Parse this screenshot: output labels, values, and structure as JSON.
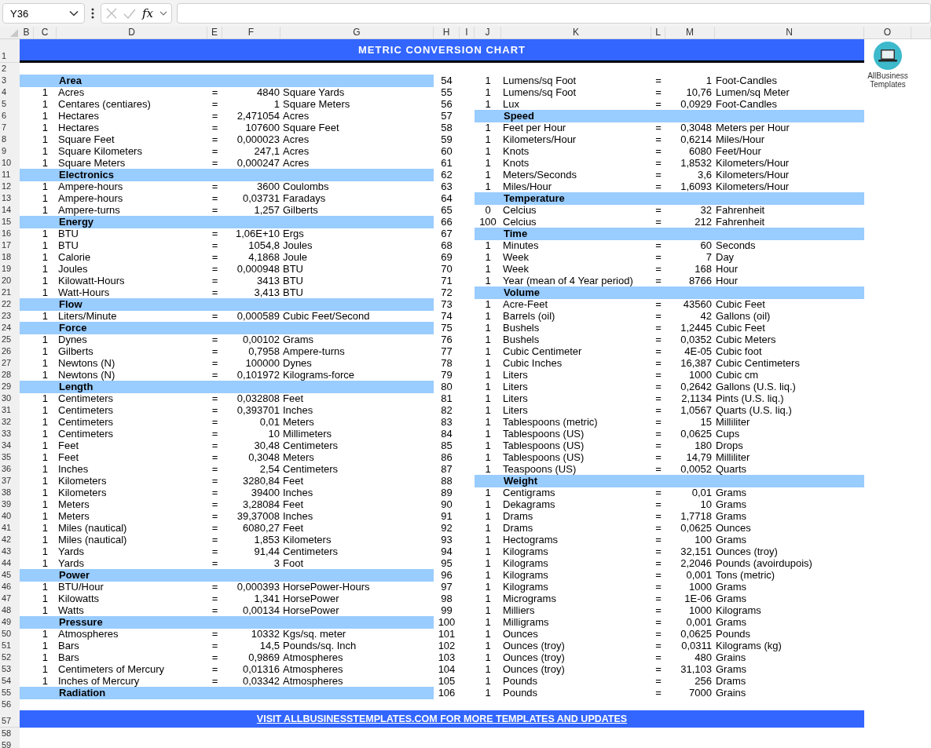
{
  "formula_bar": {
    "name_box": "Y36",
    "fx": "fx"
  },
  "columns": [
    "B",
    "C",
    "D",
    "E",
    "F",
    "G",
    "H",
    "I",
    "J",
    "K",
    "L",
    "M",
    "N",
    "O"
  ],
  "logo": {
    "text": "AllBusiness Templates"
  },
  "rows": [
    {
      "header": "1",
      "kind": "title",
      "text": "METRIC CONVERSION CHART"
    },
    {
      "header": "2",
      "kind": "blank"
    },
    {
      "header": "3",
      "kind": "data",
      "left": {
        "kind": "category",
        "label": "Area"
      },
      "right": {
        "number": "54",
        "kind": "conversion",
        "qty": "1",
        "from": "Lumens/sq Foot",
        "eq": "=",
        "value": "1",
        "unit": "Foot-Candles"
      }
    },
    {
      "header": "4",
      "kind": "data",
      "left": {
        "kind": "conversion",
        "qty": "1",
        "from": "Acres",
        "eq": "=",
        "value": "4840",
        "unit": "Square Yards"
      },
      "right": {
        "number": "55",
        "kind": "conversion",
        "qty": "1",
        "from": "Lumens/sq Foot",
        "eq": "=",
        "value": "10,76",
        "unit": "Lumen/sq Meter"
      }
    },
    {
      "header": "5",
      "kind": "data",
      "left": {
        "kind": "conversion",
        "qty": "1",
        "from": "Centares (centiares)",
        "eq": "=",
        "value": "1",
        "unit": "Square Meters"
      },
      "right": {
        "number": "56",
        "kind": "conversion",
        "qty": "1",
        "from": "Lux",
        "eq": "=",
        "value": "0,0929",
        "unit": "Foot-Candles"
      }
    },
    {
      "header": "6",
      "kind": "data",
      "left": {
        "kind": "conversion",
        "qty": "1",
        "from": "Hectares",
        "eq": "=",
        "value": "2,471054",
        "unit": "Acres"
      },
      "right": {
        "number": "57",
        "kind": "category",
        "label": "Speed"
      }
    },
    {
      "header": "7",
      "kind": "data",
      "left": {
        "kind": "conversion",
        "qty": "1",
        "from": "Hectares",
        "eq": "=",
        "value": "107600",
        "unit": "Square Feet"
      },
      "right": {
        "number": "58",
        "kind": "conversion",
        "qty": "1",
        "from": "Feet per Hour",
        "eq": "=",
        "value": "0,3048",
        "unit": "Meters per Hour"
      }
    },
    {
      "header": "8",
      "kind": "data",
      "left": {
        "kind": "conversion",
        "qty": "1",
        "from": "Square Feet",
        "eq": "=",
        "value": "0,000023",
        "unit": "Acres"
      },
      "right": {
        "number": "59",
        "kind": "conversion",
        "qty": "1",
        "from": "Kilometers/Hour",
        "eq": "=",
        "value": "0,6214",
        "unit": "Miles/Hour"
      }
    },
    {
      "header": "9",
      "kind": "data",
      "left": {
        "kind": "conversion",
        "qty": "1",
        "from": "Square Kilometers",
        "eq": "=",
        "value": "247,1",
        "unit": "Acres"
      },
      "right": {
        "number": "60",
        "kind": "conversion",
        "qty": "1",
        "from": "Knots",
        "eq": "=",
        "value": "6080",
        "unit": "Feet/Hour"
      }
    },
    {
      "header": "10",
      "kind": "data",
      "left": {
        "kind": "conversion",
        "qty": "1",
        "from": "Square Meters",
        "eq": "=",
        "value": "0,000247",
        "unit": "Acres"
      },
      "right": {
        "number": "61",
        "kind": "conversion",
        "qty": "1",
        "from": "Knots",
        "eq": "=",
        "value": "1,8532",
        "unit": "Kilometers/Hour"
      }
    },
    {
      "header": "11",
      "kind": "data",
      "left": {
        "kind": "category",
        "label": "Electronics"
      },
      "right": {
        "number": "62",
        "kind": "conversion",
        "qty": "1",
        "from": "Meters/Seconds",
        "eq": "=",
        "value": "3,6",
        "unit": "Kilometers/Hour"
      }
    },
    {
      "header": "12",
      "kind": "data",
      "left": {
        "kind": "conversion",
        "qty": "1",
        "from": "Ampere-hours",
        "eq": "=",
        "value": "3600",
        "unit": "Coulombs"
      },
      "right": {
        "number": "63",
        "kind": "conversion",
        "qty": "1",
        "from": "Miles/Hour",
        "eq": "=",
        "value": "1,6093",
        "unit": "Kilometers/Hour"
      }
    },
    {
      "header": "13",
      "kind": "data",
      "left": {
        "kind": "conversion",
        "qty": "1",
        "from": "Ampere-hours",
        "eq": "=",
        "value": "0,03731",
        "unit": "Faradays"
      },
      "right": {
        "number": "64",
        "kind": "category",
        "label": "Temperature"
      }
    },
    {
      "header": "14",
      "kind": "data",
      "left": {
        "kind": "conversion",
        "qty": "1",
        "from": "Ampere-turns",
        "eq": "=",
        "value": "1,257",
        "unit": "Gilberts"
      },
      "right": {
        "number": "65",
        "kind": "conversion",
        "qty": "0",
        "from": "Celcius",
        "eq": "=",
        "value": "32",
        "unit": "Fahrenheit"
      }
    },
    {
      "header": "15",
      "kind": "data",
      "left": {
        "kind": "category",
        "label": "Energy"
      },
      "right": {
        "number": "66",
        "kind": "conversion",
        "qty": "100",
        "from": "Celcius",
        "eq": "=",
        "value": "212",
        "unit": "Fahrenheit"
      }
    },
    {
      "header": "16",
      "kind": "data",
      "left": {
        "kind": "conversion",
        "qty": "1",
        "from": "BTU",
        "eq": "=",
        "value": "1,06E+10",
        "unit": "Ergs"
      },
      "right": {
        "number": "67",
        "kind": "category",
        "label": "Time"
      }
    },
    {
      "header": "17",
      "kind": "data",
      "left": {
        "kind": "conversion",
        "qty": "1",
        "from": "BTU",
        "eq": "=",
        "value": "1054,8",
        "unit": "Joules"
      },
      "right": {
        "number": "68",
        "kind": "conversion",
        "qty": "1",
        "from": "Minutes",
        "eq": "=",
        "value": "60",
        "unit": "Seconds"
      }
    },
    {
      "header": "18",
      "kind": "data",
      "left": {
        "kind": "conversion",
        "qty": "1",
        "from": "Calorie",
        "eq": "=",
        "value": "4,1868",
        "unit": "Joule"
      },
      "right": {
        "number": "69",
        "kind": "conversion",
        "qty": "1",
        "from": "Week",
        "eq": "=",
        "value": "7",
        "unit": "Day"
      }
    },
    {
      "header": "19",
      "kind": "data",
      "left": {
        "kind": "conversion",
        "qty": "1",
        "from": "Joules",
        "eq": "=",
        "value": "0,000948",
        "unit": "BTU"
      },
      "right": {
        "number": "70",
        "kind": "conversion",
        "qty": "1",
        "from": "Week",
        "eq": "=",
        "value": "168",
        "unit": "Hour"
      }
    },
    {
      "header": "20",
      "kind": "data",
      "left": {
        "kind": "conversion",
        "qty": "1",
        "from": "Kilowatt-Hours",
        "eq": "=",
        "value": "3413",
        "unit": "BTU"
      },
      "right": {
        "number": "71",
        "kind": "conversion",
        "qty": "1",
        "from": "Year (mean of 4 Year period)",
        "eq": "=",
        "value": "8766",
        "unit": "Hour"
      }
    },
    {
      "header": "21",
      "kind": "data",
      "left": {
        "kind": "conversion",
        "qty": "1",
        "from": "Watt-Hours",
        "eq": "=",
        "value": "3,413",
        "unit": "BTU"
      },
      "right": {
        "number": "72",
        "kind": "category",
        "label": "Volume"
      }
    },
    {
      "header": "22",
      "kind": "data",
      "left": {
        "kind": "category",
        "label": "Flow"
      },
      "right": {
        "number": "73",
        "kind": "conversion",
        "qty": "1",
        "from": "Acre-Feet",
        "eq": "=",
        "value": "43560",
        "unit": "Cubic Feet"
      }
    },
    {
      "header": "23",
      "kind": "data",
      "left": {
        "kind": "conversion",
        "qty": "1",
        "from": "Liters/Minute",
        "eq": "=",
        "value": "0,000589",
        "unit": "Cubic Feet/Second"
      },
      "right": {
        "number": "74",
        "kind": "conversion",
        "qty": "1",
        "from": "Barrels (oil)",
        "eq": "=",
        "value": "42",
        "unit": "Gallons (oil)"
      }
    },
    {
      "header": "24",
      "kind": "data",
      "left": {
        "kind": "category",
        "label": "Force"
      },
      "right": {
        "number": "75",
        "kind": "conversion",
        "qty": "1",
        "from": "Bushels",
        "eq": "=",
        "value": "1,2445",
        "unit": "Cubic Feet"
      }
    },
    {
      "header": "25",
      "kind": "data",
      "left": {
        "kind": "conversion",
        "qty": "1",
        "from": "Dynes",
        "eq": "=",
        "value": "0,00102",
        "unit": "Grams"
      },
      "right": {
        "number": "76",
        "kind": "conversion",
        "qty": "1",
        "from": "Bushels",
        "eq": "=",
        "value": "0,0352",
        "unit": "Cubic Meters"
      }
    },
    {
      "header": "26",
      "kind": "data",
      "left": {
        "kind": "conversion",
        "qty": "1",
        "from": "Gilberts",
        "eq": "=",
        "value": "0,7958",
        "unit": "Ampere-turns"
      },
      "right": {
        "number": "77",
        "kind": "conversion",
        "qty": "1",
        "from": "Cubic Centimeter",
        "eq": "=",
        "value": "4E-05",
        "unit": "Cubic foot"
      }
    },
    {
      "header": "27",
      "kind": "data",
      "left": {
        "kind": "conversion",
        "qty": "1",
        "from": "Newtons (N)",
        "eq": "=",
        "value": "100000",
        "unit": "Dynes"
      },
      "right": {
        "number": "78",
        "kind": "conversion",
        "qty": "1",
        "from": "Cubic Inches",
        "eq": "=",
        "value": "16,387",
        "unit": "Cubic Centimeters"
      }
    },
    {
      "header": "28",
      "kind": "data",
      "left": {
        "kind": "conversion",
        "qty": "1",
        "from": "Newtons (N)",
        "eq": "=",
        "value": "0,101972",
        "unit": "Kilograms-force"
      },
      "right": {
        "number": "79",
        "kind": "conversion",
        "qty": "1",
        "from": "Liters",
        "eq": "=",
        "value": "1000",
        "unit": "Cubic cm"
      }
    },
    {
      "header": "29",
      "kind": "data",
      "left": {
        "kind": "category",
        "label": "Length"
      },
      "right": {
        "number": "80",
        "kind": "conversion",
        "qty": "1",
        "from": "Liters",
        "eq": "=",
        "value": "0,2642",
        "unit": "Gallons (U.S. liq.)"
      }
    },
    {
      "header": "30",
      "kind": "data",
      "left": {
        "kind": "conversion",
        "qty": "1",
        "from": "Centimeters",
        "eq": "=",
        "value": "0,032808",
        "unit": "Feet"
      },
      "right": {
        "number": "81",
        "kind": "conversion",
        "qty": "1",
        "from": "Liters",
        "eq": "=",
        "value": "2,1134",
        "unit": "Pints (U.S. liq.)"
      }
    },
    {
      "header": "31",
      "kind": "data",
      "left": {
        "kind": "conversion",
        "qty": "1",
        "from": "Centimeters",
        "eq": "=",
        "value": "0,393701",
        "unit": "Inches"
      },
      "right": {
        "number": "82",
        "kind": "conversion",
        "qty": "1",
        "from": "Liters",
        "eq": "=",
        "value": "1,0567",
        "unit": "Quarts (U.S. liq.)"
      }
    },
    {
      "header": "32",
      "kind": "data",
      "left": {
        "kind": "conversion",
        "qty": "1",
        "from": "Centimeters",
        "eq": "=",
        "value": "0,01",
        "unit": "Meters"
      },
      "right": {
        "number": "83",
        "kind": "conversion",
        "qty": "1",
        "from": "Tablespoons (metric)",
        "eq": "=",
        "value": "15",
        "unit": "Milliliter"
      }
    },
    {
      "header": "33",
      "kind": "data",
      "left": {
        "kind": "conversion",
        "qty": "1",
        "from": "Centimeters",
        "eq": "=",
        "value": "10",
        "unit": "Millimeters"
      },
      "right": {
        "number": "84",
        "kind": "conversion",
        "qty": "1",
        "from": "Tablespoons (US)",
        "eq": "=",
        "value": "0,0625",
        "unit": "Cups"
      }
    },
    {
      "header": "34",
      "kind": "data",
      "left": {
        "kind": "conversion",
        "qty": "1",
        "from": "Feet",
        "eq": "=",
        "value": "30,48",
        "unit": "Centimeters"
      },
      "right": {
        "number": "85",
        "kind": "conversion",
        "qty": "1",
        "from": "Tablespoons (US)",
        "eq": "=",
        "value": "180",
        "unit": "Drops"
      }
    },
    {
      "header": "35",
      "kind": "data",
      "left": {
        "kind": "conversion",
        "qty": "1",
        "from": "Feet",
        "eq": "=",
        "value": "0,3048",
        "unit": "Meters"
      },
      "right": {
        "number": "86",
        "kind": "conversion",
        "qty": "1",
        "from": "Tablespoons (US)",
        "eq": "=",
        "value": "14,79",
        "unit": "Milliliter"
      }
    },
    {
      "header": "36",
      "kind": "data",
      "left": {
        "kind": "conversion",
        "qty": "1",
        "from": "Inches",
        "eq": "=",
        "value": "2,54",
        "unit": "Centimeters"
      },
      "right": {
        "number": "87",
        "kind": "conversion",
        "qty": "1",
        "from": "Teaspoons (US)",
        "eq": "=",
        "value": "0,0052",
        "unit": "Quarts"
      }
    },
    {
      "header": "37",
      "kind": "data",
      "left": {
        "kind": "conversion",
        "qty": "1",
        "from": "Kilometers",
        "eq": "=",
        "value": "3280,84",
        "unit": "Feet"
      },
      "right": {
        "number": "88",
        "kind": "category",
        "label": "Weight"
      }
    },
    {
      "header": "38",
      "kind": "data",
      "left": {
        "kind": "conversion",
        "qty": "1",
        "from": "Kilometers",
        "eq": "=",
        "value": "39400",
        "unit": "Inches"
      },
      "right": {
        "number": "89",
        "kind": "conversion",
        "qty": "1",
        "from": "Centigrams",
        "eq": "=",
        "value": "0,01",
        "unit": "Grams"
      }
    },
    {
      "header": "39",
      "kind": "data",
      "left": {
        "kind": "conversion",
        "qty": "1",
        "from": "Meters",
        "eq": "=",
        "value": "3,28084",
        "unit": "Feet"
      },
      "right": {
        "number": "90",
        "kind": "conversion",
        "qty": "1",
        "from": "Dekagrams",
        "eq": "=",
        "value": "10",
        "unit": "Grams"
      }
    },
    {
      "header": "40",
      "kind": "data",
      "left": {
        "kind": "conversion",
        "qty": "1",
        "from": "Meters",
        "eq": "=",
        "value": "39,37008",
        "unit": "Inches"
      },
      "right": {
        "number": "91",
        "kind": "conversion",
        "qty": "1",
        "from": "Drams",
        "eq": "=",
        "value": "1,7718",
        "unit": "Grams"
      }
    },
    {
      "header": "41",
      "kind": "data",
      "left": {
        "kind": "conversion",
        "qty": "1",
        "from": "Miles (nautical)",
        "eq": "=",
        "value": "6080,27",
        "unit": "Feet"
      },
      "right": {
        "number": "92",
        "kind": "conversion",
        "qty": "1",
        "from": "Drams",
        "eq": "=",
        "value": "0,0625",
        "unit": "Ounces"
      }
    },
    {
      "header": "42",
      "kind": "data",
      "left": {
        "kind": "conversion",
        "qty": "1",
        "from": "Miles (nautical)",
        "eq": "=",
        "value": "1,853",
        "unit": "Kilometers"
      },
      "right": {
        "number": "93",
        "kind": "conversion",
        "qty": "1",
        "from": "Hectograms",
        "eq": "=",
        "value": "100",
        "unit": "Grams"
      }
    },
    {
      "header": "43",
      "kind": "data",
      "left": {
        "kind": "conversion",
        "qty": "1",
        "from": "Yards",
        "eq": "=",
        "value": "91,44",
        "unit": "Centimeters"
      },
      "right": {
        "number": "94",
        "kind": "conversion",
        "qty": "1",
        "from": "Kilograms",
        "eq": "=",
        "value": "32,151",
        "unit": "Ounces (troy)"
      }
    },
    {
      "header": "44",
      "kind": "data",
      "left": {
        "kind": "conversion",
        "qty": "1",
        "from": "Yards",
        "eq": "=",
        "value": "3",
        "unit": "Foot"
      },
      "right": {
        "number": "95",
        "kind": "conversion",
        "qty": "1",
        "from": "Kilograms",
        "eq": "=",
        "value": "2,2046",
        "unit": "Pounds (avoirdupois)"
      }
    },
    {
      "header": "45",
      "kind": "data",
      "left": {
        "kind": "category",
        "label": "Power"
      },
      "right": {
        "number": "96",
        "kind": "conversion",
        "qty": "1",
        "from": "Kilograms",
        "eq": "=",
        "value": "0,001",
        "unit": "Tons (metric)"
      }
    },
    {
      "header": "46",
      "kind": "data",
      "left": {
        "kind": "conversion",
        "qty": "1",
        "from": "BTU/Hour",
        "eq": "=",
        "value": "0,000393",
        "unit": "HorsePower-Hours"
      },
      "right": {
        "number": "97",
        "kind": "conversion",
        "qty": "1",
        "from": "Kilograms",
        "eq": "=",
        "value": "1000",
        "unit": "Grams"
      }
    },
    {
      "header": "47",
      "kind": "data",
      "left": {
        "kind": "conversion",
        "qty": "1",
        "from": "Kilowatts",
        "eq": "=",
        "value": "1,341",
        "unit": "HorsePower"
      },
      "right": {
        "number": "98",
        "kind": "conversion",
        "qty": "1",
        "from": "Micrograms",
        "eq": "=",
        "value": "1E-06",
        "unit": "Grams"
      }
    },
    {
      "header": "48",
      "kind": "data",
      "left": {
        "kind": "conversion",
        "qty": "1",
        "from": "Watts",
        "eq": "=",
        "value": "0,00134",
        "unit": "HorsePower"
      },
      "right": {
        "number": "99",
        "kind": "conversion",
        "qty": "1",
        "from": "Milliers",
        "eq": "=",
        "value": "1000",
        "unit": "Kilograms"
      }
    },
    {
      "header": "49",
      "kind": "data",
      "left": {
        "kind": "category",
        "label": "Pressure"
      },
      "right": {
        "number": "100",
        "kind": "conversion",
        "qty": "1",
        "from": "Milligrams",
        "eq": "=",
        "value": "0,001",
        "unit": "Grams"
      }
    },
    {
      "header": "50",
      "kind": "data",
      "left": {
        "kind": "conversion",
        "qty": "1",
        "from": "Atmospheres",
        "eq": "=",
        "value": "10332",
        "unit": "Kgs/sq. meter"
      },
      "right": {
        "number": "101",
        "kind": "conversion",
        "qty": "1",
        "from": "Ounces",
        "eq": "=",
        "value": "0,0625",
        "unit": "Pounds"
      }
    },
    {
      "header": "51",
      "kind": "data",
      "left": {
        "kind": "conversion",
        "qty": "1",
        "from": "Bars",
        "eq": "=",
        "value": "14,5",
        "unit": "Pounds/sq. Inch"
      },
      "right": {
        "number": "102",
        "kind": "conversion",
        "qty": "1",
        "from": "Ounces (troy)",
        "eq": "=",
        "value": "0,0311",
        "unit": "Kilograms (kg)"
      }
    },
    {
      "header": "52",
      "kind": "data",
      "left": {
        "kind": "conversion",
        "qty": "1",
        "from": "Bars",
        "eq": "=",
        "value": "0,9869",
        "unit": "Atmospheres"
      },
      "right": {
        "number": "103",
        "kind": "conversion",
        "qty": "1",
        "from": "Ounces (troy)",
        "eq": "=",
        "value": "480",
        "unit": "Grains"
      }
    },
    {
      "header": "53",
      "kind": "data",
      "left": {
        "kind": "conversion",
        "qty": "1",
        "from": "Centimeters of Mercury",
        "eq": "=",
        "value": "0,01316",
        "unit": "Atmospheres"
      },
      "right": {
        "number": "104",
        "kind": "conversion",
        "qty": "1",
        "from": "Ounces (troy)",
        "eq": "=",
        "value": "31,103",
        "unit": "Grams"
      }
    },
    {
      "header": "54",
      "kind": "data",
      "left": {
        "kind": "conversion",
        "qty": "1",
        "from": "Inches of Mercury",
        "eq": "=",
        "value": "0,03342",
        "unit": "Atmospheres"
      },
      "right": {
        "number": "105",
        "kind": "conversion",
        "qty": "1",
        "from": "Pounds",
        "eq": "=",
        "value": "256",
        "unit": "Drams"
      }
    },
    {
      "header": "55",
      "kind": "data",
      "left": {
        "kind": "category",
        "label": "Radiation"
      },
      "right": {
        "number": "106",
        "kind": "conversion",
        "qty": "1",
        "from": "Pounds",
        "eq": "=",
        "value": "7000",
        "unit": "Grains"
      }
    },
    {
      "header": "56",
      "kind": "blank"
    },
    {
      "header": "57",
      "kind": "footer",
      "link": "VISIT ALLBUSINESSTEMPLATES.COM FOR MORE TEMPLATES AND UPDATES"
    },
    {
      "header": "58",
      "kind": "blank"
    },
    {
      "header": "59",
      "kind": "blank"
    }
  ]
}
